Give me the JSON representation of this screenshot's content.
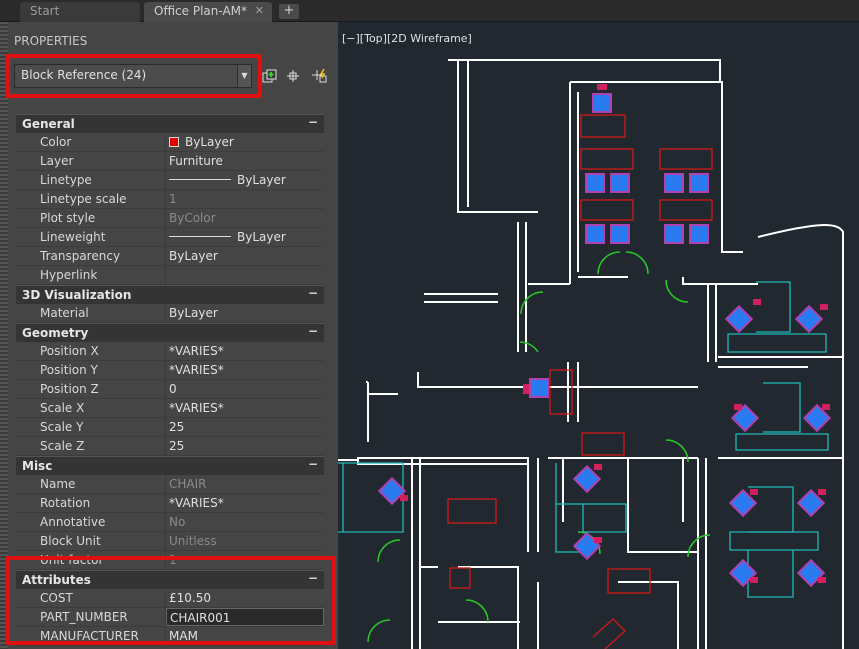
{
  "tabs": [
    {
      "label": "Start"
    },
    {
      "label": "Office Plan-AM*",
      "close": "✕"
    }
  ],
  "tab_add": "+",
  "palette": {
    "title": "PROPERTIES",
    "selection": "Block Reference (24)"
  },
  "sections": {
    "general": "General",
    "viz": "3D Visualization",
    "geometry": "Geometry",
    "misc": "Misc",
    "attributes": "Attributes",
    "toggle": "−"
  },
  "general": [
    {
      "name": "Color",
      "value": "ByLayer"
    },
    {
      "name": "Layer",
      "value": "Furniture"
    },
    {
      "name": "Linetype",
      "value": "ByLayer"
    },
    {
      "name": "Linetype scale",
      "value": "1"
    },
    {
      "name": "Plot style",
      "value": "ByColor"
    },
    {
      "name": "Lineweight",
      "value": "ByLayer"
    },
    {
      "name": "Transparency",
      "value": "ByLayer"
    },
    {
      "name": "Hyperlink",
      "value": ""
    }
  ],
  "viz": [
    {
      "name": "Material",
      "value": "ByLayer"
    }
  ],
  "geometry": [
    {
      "name": "Position X",
      "value": "*VARIES*"
    },
    {
      "name": "Position Y",
      "value": "*VARIES*"
    },
    {
      "name": "Position Z",
      "value": "0"
    },
    {
      "name": "Scale X",
      "value": "*VARIES*"
    },
    {
      "name": "Scale Y",
      "value": "25"
    },
    {
      "name": "Scale Z",
      "value": "25"
    }
  ],
  "misc": [
    {
      "name": "Name",
      "value": "CHAIR"
    },
    {
      "name": "Rotation",
      "value": "*VARIES*"
    },
    {
      "name": "Annotative",
      "value": "No"
    },
    {
      "name": "Block Unit",
      "value": "Unitless"
    },
    {
      "name": "Unit factor",
      "value": "1"
    }
  ],
  "attributes": [
    {
      "name": "COST",
      "value": "£10.50"
    },
    {
      "name": "PART_NUMBER",
      "value": "CHAIR001"
    },
    {
      "name": "MANUFACTURER",
      "value": "MAM"
    }
  ],
  "viewport": {
    "label": "[−][Top][2D Wireframe]"
  },
  "colors": {
    "wall": "#ffffff",
    "furniture_red": "#d01818",
    "chair_fill": "#2a7af0",
    "chair_outline": "#b040b0",
    "partition": "#20b8b8",
    "door_arc": "#28c828",
    "highlight": "#e01010"
  },
  "icons": [
    "dropdown-arrow-icon",
    "quick-select-icon",
    "select-objects-icon",
    "pickadd-toggle-icon",
    "close-icon",
    "plus-icon"
  ]
}
